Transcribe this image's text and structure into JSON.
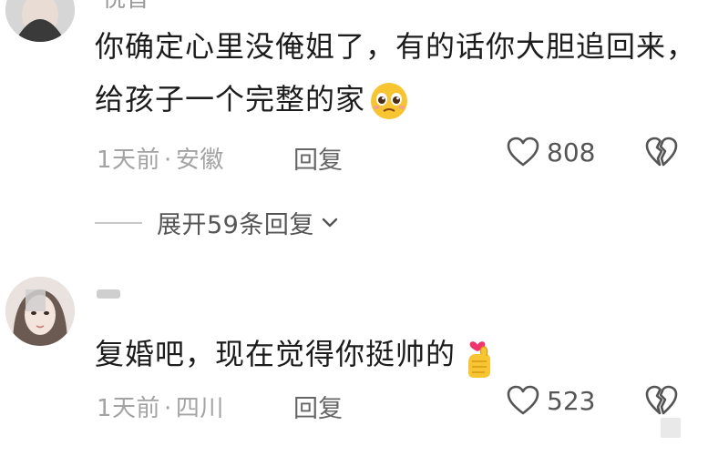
{
  "comments": [
    {
      "username": "悦音",
      "text": "你确定心里没俺姐了，有的话你大胆追回来，给孩子一个完整的家",
      "emoji_icon": "pleading-face-emoji",
      "time": "1天前",
      "separator": "·",
      "location": "安徽",
      "reply_label": "回复",
      "like_count": "808"
    },
    {
      "username": "",
      "text": "复婚吧，现在觉得你挺帅的",
      "emoji_icon": "finger-heart-emoji",
      "time": "1天前",
      "separator": "·",
      "location": "四川",
      "reply_label": "回复",
      "like_count": "523"
    }
  ],
  "expand_replies": {
    "label": "展开59条回复"
  },
  "colors": {
    "text": "#1c1c1c",
    "meta": "#a3a3a3",
    "emoji_yellow": "#f7c531",
    "heart_pink": "#f0346d"
  }
}
